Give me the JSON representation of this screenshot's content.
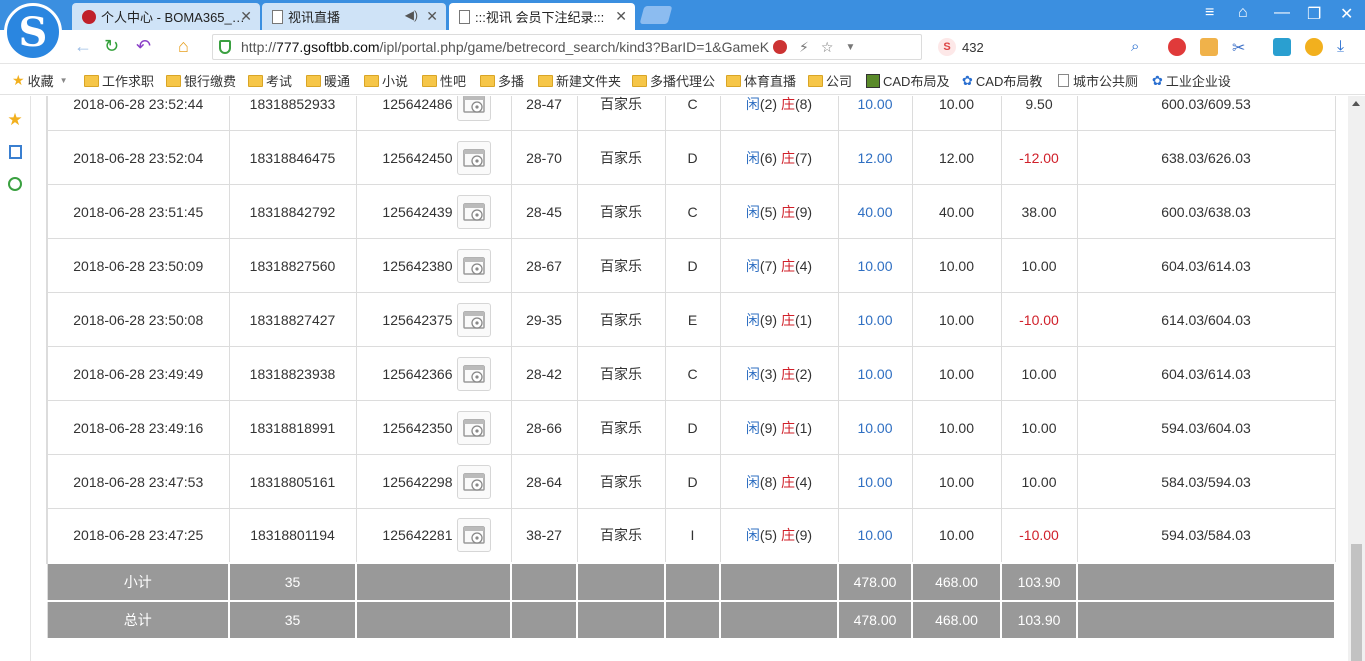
{
  "browser": {
    "tabs": [
      {
        "title": "个人中心 - BOMA365_…",
        "active": false
      },
      {
        "title": "视讯直播",
        "active": false
      },
      {
        "title": ":::视讯 会员下注纪录:::",
        "active": true
      }
    ],
    "url_prefix": "http://",
    "url_host": "777.gsoftbb.com",
    "url_rest": "/ipl/portal.php/game/betrecord_search/kind3?BarID=1&GameK",
    "search_text": "432",
    "search_badge": "S"
  },
  "bookmarks": [
    {
      "label": "收藏",
      "icon": "star-icon"
    },
    {
      "label": "工作求职",
      "icon": "folder-icon"
    },
    {
      "label": "银行缴费",
      "icon": "folder-icon"
    },
    {
      "label": "考试",
      "icon": "folder-icon"
    },
    {
      "label": "暖通",
      "icon": "folder-icon"
    },
    {
      "label": "小说",
      "icon": "folder-icon"
    },
    {
      "label": "性吧",
      "icon": "folder-icon"
    },
    {
      "label": "多播",
      "icon": "folder-icon"
    },
    {
      "label": "新建文件夹",
      "icon": "folder-icon"
    },
    {
      "label": "多播代理公",
      "icon": "folder-icon"
    },
    {
      "label": "体育直播",
      "icon": "folder-icon"
    },
    {
      "label": "公司",
      "icon": "folder-icon"
    },
    {
      "label": "CAD布局及",
      "icon": "cad-icon"
    },
    {
      "label": "CAD布局教",
      "icon": "paw-icon"
    },
    {
      "label": "城市公共厕",
      "icon": "page-icon"
    },
    {
      "label": "工业企业设",
      "icon": "paw-icon"
    }
  ],
  "rows": [
    {
      "time": "2018-06-28 23:52:44",
      "order": "18318852933",
      "game_id": "125642486",
      "table": "28-47",
      "game": "百家乐",
      "room": "C",
      "xian_label": "闲",
      "xian": "(2)",
      "zhuang_label": "庄",
      "zhuang": "(8)",
      "bet": "10.00",
      "valid": "10.00",
      "result": "9.50",
      "balance": "600.03/609.53",
      "neg": false
    },
    {
      "time": "2018-06-28 23:52:04",
      "order": "18318846475",
      "game_id": "125642450",
      "table": "28-70",
      "game": "百家乐",
      "room": "D",
      "xian_label": "闲",
      "xian": "(6)",
      "zhuang_label": "庄",
      "zhuang": "(7)",
      "bet": "12.00",
      "valid": "12.00",
      "result": "-12.00",
      "balance": "638.03/626.03",
      "neg": true
    },
    {
      "time": "2018-06-28 23:51:45",
      "order": "18318842792",
      "game_id": "125642439",
      "table": "28-45",
      "game": "百家乐",
      "room": "C",
      "xian_label": "闲",
      "xian": "(5)",
      "zhuang_label": "庄",
      "zhuang": "(9)",
      "bet": "40.00",
      "valid": "40.00",
      "result": "38.00",
      "balance": "600.03/638.03",
      "neg": false
    },
    {
      "time": "2018-06-28 23:50:09",
      "order": "18318827560",
      "game_id": "125642380",
      "table": "28-67",
      "game": "百家乐",
      "room": "D",
      "xian_label": "闲",
      "xian": "(7)",
      "zhuang_label": "庄",
      "zhuang": "(4)",
      "bet": "10.00",
      "valid": "10.00",
      "result": "10.00",
      "balance": "604.03/614.03",
      "neg": false
    },
    {
      "time": "2018-06-28 23:50:08",
      "order": "18318827427",
      "game_id": "125642375",
      "table": "29-35",
      "game": "百家乐",
      "room": "E",
      "xian_label": "闲",
      "xian": "(9)",
      "zhuang_label": "庄",
      "zhuang": "(1)",
      "bet": "10.00",
      "valid": "10.00",
      "result": "-10.00",
      "balance": "614.03/604.03",
      "neg": true
    },
    {
      "time": "2018-06-28 23:49:49",
      "order": "18318823938",
      "game_id": "125642366",
      "table": "28-42",
      "game": "百家乐",
      "room": "C",
      "xian_label": "闲",
      "xian": "(3)",
      "zhuang_label": "庄",
      "zhuang": "(2)",
      "bet": "10.00",
      "valid": "10.00",
      "result": "10.00",
      "balance": "604.03/614.03",
      "neg": false
    },
    {
      "time": "2018-06-28 23:49:16",
      "order": "18318818991",
      "game_id": "125642350",
      "table": "28-66",
      "game": "百家乐",
      "room": "D",
      "xian_label": "闲",
      "xian": "(9)",
      "zhuang_label": "庄",
      "zhuang": "(1)",
      "bet": "10.00",
      "valid": "10.00",
      "result": "10.00",
      "balance": "594.03/604.03",
      "neg": false
    },
    {
      "time": "2018-06-28 23:47:53",
      "order": "18318805161",
      "game_id": "125642298",
      "table": "28-64",
      "game": "百家乐",
      "room": "D",
      "xian_label": "闲",
      "xian": "(8)",
      "zhuang_label": "庄",
      "zhuang": "(4)",
      "bet": "10.00",
      "valid": "10.00",
      "result": "10.00",
      "balance": "584.03/594.03",
      "neg": false
    },
    {
      "time": "2018-06-28 23:47:25",
      "order": "18318801194",
      "game_id": "125642281",
      "table": "38-27",
      "game": "百家乐",
      "room": "I",
      "xian_label": "闲",
      "xian": "(5)",
      "zhuang_label": "庄",
      "zhuang": "(9)",
      "bet": "10.00",
      "valid": "10.00",
      "result": "-10.00",
      "balance": "594.03/584.03",
      "neg": true
    }
  ],
  "subtotal": {
    "label": "小计",
    "count": "35",
    "bet": "478.00",
    "valid": "468.00",
    "result": "103.90"
  },
  "total": {
    "label": "总计",
    "count": "35",
    "bet": "478.00",
    "valid": "468.00",
    "result": "103.90"
  },
  "colors": {
    "accent": "#3b8fe0",
    "negative": "#d0202a",
    "link_blue": "#2f6fc2",
    "summary_bg": "#999999"
  }
}
